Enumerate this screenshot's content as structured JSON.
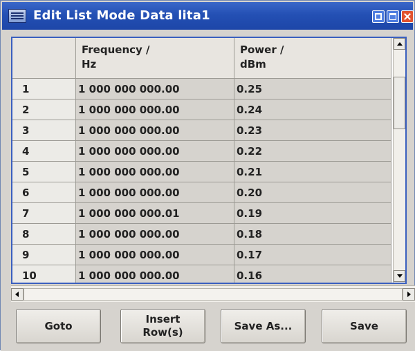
{
  "window": {
    "title": "Edit List Mode Data lita1"
  },
  "table": {
    "headers": {
      "frequency_line1": "Frequency /",
      "frequency_line2": "Hz",
      "power_line1": "Power /",
      "power_line2": "dBm"
    },
    "rows": [
      {
        "index": "1",
        "frequency": "1 000 000 000.00",
        "power": "0.25"
      },
      {
        "index": "2",
        "frequency": "1 000 000 000.00",
        "power": "0.24"
      },
      {
        "index": "3",
        "frequency": "1 000 000 000.00",
        "power": "0.23"
      },
      {
        "index": "4",
        "frequency": "1 000 000 000.00",
        "power": "0.22"
      },
      {
        "index": "5",
        "frequency": "1 000 000 000.00",
        "power": "0.21"
      },
      {
        "index": "6",
        "frequency": "1 000 000 000.00",
        "power": "0.20"
      },
      {
        "index": "7",
        "frequency": "1 000 000 000.01",
        "power": "0.19"
      },
      {
        "index": "8",
        "frequency": "1 000 000 000.00",
        "power": "0.18"
      },
      {
        "index": "9",
        "frequency": "1 000 000 000.00",
        "power": "0.17"
      },
      {
        "index": "10",
        "frequency": "1 000 000 000.00",
        "power": "0.16"
      }
    ]
  },
  "buttons": {
    "goto": "Goto",
    "insert_rows": "Insert\nRow(s)",
    "save_as": "Save As...",
    "save": "Save"
  },
  "colors": {
    "titlebar": "#2450b4",
    "frame_border": "#3a5fbf",
    "close_button": "#e2532f"
  }
}
